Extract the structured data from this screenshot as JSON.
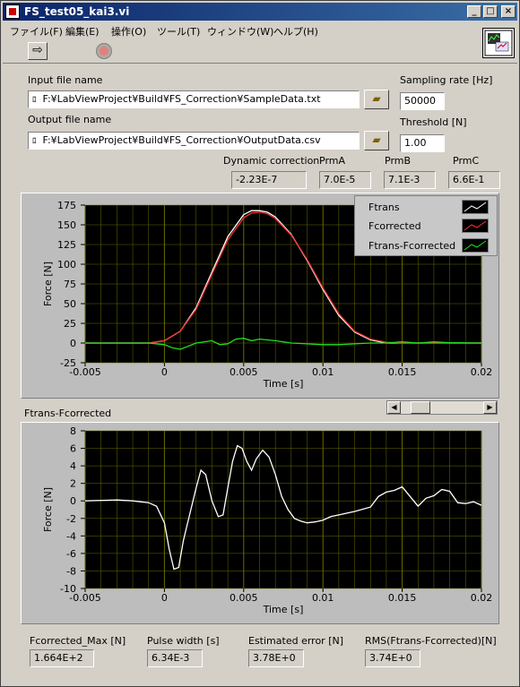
{
  "window": {
    "title": "FS_test05_kai3.vi",
    "minimize_glyph": "_",
    "maximize_glyph": "□",
    "close_glyph": "×"
  },
  "menu": {
    "items": [
      "ファイル(F)",
      "編集(E)",
      "操作(O)",
      "ツール(T)",
      "ウィンドウ(W)",
      "ヘルプ(H)"
    ]
  },
  "toolbar": {
    "run_icon": "run-arrow-icon",
    "run_glyph": "⇨",
    "stop_icon": "abort-stop-icon"
  },
  "controls": {
    "input_file_label": "Input file name",
    "input_file_value": "F:¥LabViewProject¥Build¥FS_Correction¥SampleData.txt",
    "output_file_label": "Output file name",
    "output_file_value": "F:¥LabViewProject¥Build¥FS_Correction¥OutputData.csv",
    "sampling_rate_label": "Sampling rate [Hz]",
    "sampling_rate_value": "50000",
    "threshold_label": "Threshold [N]",
    "threshold_value": "1.00",
    "dynamic_correction_label": "Dynamic correction",
    "dynamic_correction_value": "-2.23E-7",
    "prmA_label": "PrmA",
    "prmA_value": "7.0E-5",
    "prmB_label": "PrmB",
    "prmB_value": "7.1E-3",
    "prmC_label": "PrmC",
    "prmC_value": "6.6E-1",
    "path_glyph": "ﾛ",
    "browse_glyph": "▰"
  },
  "indicators": {
    "fcorrected_max_label": "Fcorrected_Max [N]",
    "fcorrected_max_value": "1.664E+2",
    "pulse_width_label": "Pulse width [s]",
    "pulse_width_value": "6.34E-3",
    "estimated_error_label": "Estimated error [N]",
    "estimated_error_value": "3.78E+0",
    "rms_label": "RMS(Ftrans-Fcorrected)[N]",
    "rms_value": "3.74E+0"
  },
  "scrollbar": {
    "left_glyph": "◀",
    "right_glyph": "▶"
  },
  "colors": {
    "plot_bg": "#000000",
    "grid": "#6b6b00",
    "ftrans": "#ffffff",
    "fcorrected": "#ff3030",
    "diff": "#20e020"
  },
  "chart_data": [
    {
      "type": "line",
      "title": "",
      "xlabel": "Time [s]",
      "ylabel": "Force [N]",
      "xlim": [
        -0.005,
        0.02
      ],
      "ylim": [
        -25,
        175
      ],
      "x_ticks": [
        "-0.005",
        "0",
        "0.005",
        "0.01",
        "0.015",
        "0.02"
      ],
      "y_ticks": [
        "175",
        "150",
        "125",
        "100",
        "75",
        "50",
        "25",
        "0",
        "-25"
      ],
      "grid": true,
      "legend": "top-right",
      "series": [
        {
          "name": "Ftrans",
          "color": "#ffffff",
          "x": [
            -0.005,
            -0.001,
            0,
            0.001,
            0.002,
            0.003,
            0.004,
            0.005,
            0.0055,
            0.006,
            0.0065,
            0.007,
            0.008,
            0.009,
            0.01,
            0.011,
            0.012,
            0.013,
            0.014,
            0.015,
            0.016,
            0.018,
            0.02
          ],
          "y": [
            0,
            0,
            3,
            15,
            45,
            90,
            135,
            163,
            168,
            168,
            166,
            160,
            138,
            105,
            68,
            35,
            14,
            4,
            0,
            0,
            0,
            0,
            0
          ]
        },
        {
          "name": "Fcorrected",
          "color": "#ff3030",
          "x": [
            -0.005,
            -0.001,
            0,
            0.001,
            0.002,
            0.003,
            0.004,
            0.005,
            0.0055,
            0.006,
            0.0065,
            0.007,
            0.008,
            0.009,
            0.01,
            0.011,
            0.012,
            0.013,
            0.014,
            0.015,
            0.016,
            0.018,
            0.02
          ],
          "y": [
            0,
            0,
            3,
            15,
            43,
            87,
            131,
            159,
            165,
            166,
            164,
            158,
            137,
            106,
            70,
            37,
            15,
            5,
            1,
            0,
            0,
            0,
            0
          ]
        },
        {
          "name": "Ftrans-Fcorrected",
          "color": "#20e020",
          "x": [
            -0.005,
            -0.001,
            0,
            0.0005,
            0.001,
            0.002,
            0.003,
            0.0035,
            0.004,
            0.0045,
            0.005,
            0.0055,
            0.006,
            0.007,
            0.008,
            0.009,
            0.01,
            0.011,
            0.012,
            0.013,
            0.014,
            0.015,
            0.016,
            0.017,
            0.018,
            0.02
          ],
          "y": [
            0,
            0,
            -2,
            -6,
            -8,
            0,
            3,
            -2,
            -1,
            5,
            6,
            3,
            5,
            3,
            0,
            -1,
            -2,
            -2,
            -1,
            0,
            0,
            1.5,
            0,
            1.5,
            0.5,
            0
          ]
        }
      ]
    },
    {
      "type": "line",
      "title": "Ftrans-Fcorrected",
      "xlabel": "Time [s]",
      "ylabel": "Force [N]",
      "xlim": [
        -0.005,
        0.02
      ],
      "ylim": [
        -10,
        8
      ],
      "x_ticks": [
        "-0.005",
        "0",
        "0.005",
        "0.01",
        "0.015",
        "0.02"
      ],
      "y_ticks": [
        "8",
        "6",
        "4",
        "2",
        "0",
        "-2",
        "-4",
        "-6",
        "-8",
        "-10"
      ],
      "grid": true,
      "series": [
        {
          "color": "#ffffff",
          "x": [
            -0.005,
            -0.003,
            -0.002,
            -0.001,
            -0.0005,
            0,
            0.0003,
            0.0006,
            0.0009,
            0.0012,
            0.0016,
            0.002,
            0.0023,
            0.0026,
            0.003,
            0.0034,
            0.0037,
            0.004,
            0.0043,
            0.0046,
            0.0049,
            0.0052,
            0.0055,
            0.0058,
            0.0062,
            0.0066,
            0.007,
            0.0074,
            0.0078,
            0.0082,
            0.0086,
            0.009,
            0.0095,
            0.01,
            0.0105,
            0.011,
            0.012,
            0.013,
            0.0135,
            0.014,
            0.0145,
            0.015,
            0.0155,
            0.016,
            0.0165,
            0.017,
            0.0175,
            0.018,
            0.0185,
            0.019,
            0.0195,
            0.02
          ],
          "y": [
            0,
            0.1,
            0,
            -0.2,
            -0.6,
            -2.5,
            -5.5,
            -7.8,
            -7.6,
            -4.5,
            -1.5,
            1.5,
            3.5,
            3.0,
            0,
            -1.8,
            -1.6,
            1.5,
            4.5,
            6.3,
            6.0,
            4.5,
            3.5,
            4.8,
            5.8,
            5.0,
            3.0,
            0.5,
            -1.0,
            -2.0,
            -2.3,
            -2.5,
            -2.4,
            -2.2,
            -1.8,
            -1.6,
            -1.2,
            -0.7,
            0.5,
            1.0,
            1.2,
            1.6,
            0.5,
            -0.6,
            0.3,
            0.6,
            1.3,
            1.1,
            -0.2,
            -0.3,
            -0.1,
            -0.5
          ]
        }
      ]
    }
  ]
}
